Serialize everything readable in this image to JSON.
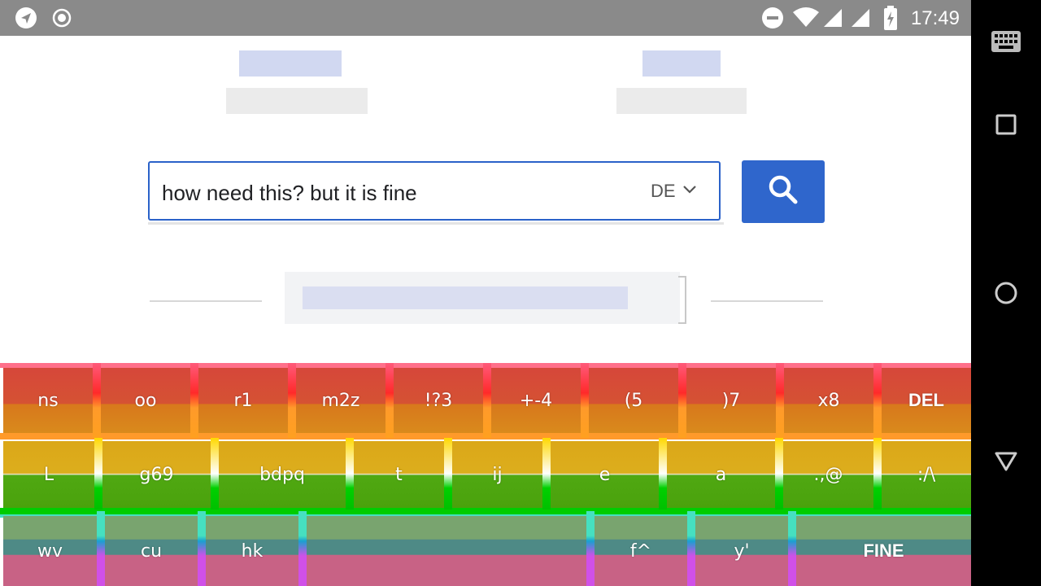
{
  "status_bar": {
    "time": "17:49",
    "icons": [
      "navigation-icon",
      "record-icon",
      "do-not-disturb-icon",
      "wifi-icon",
      "signal-icon",
      "signal-icon",
      "battery-charging-icon"
    ]
  },
  "search": {
    "query": "how need this? but it is fine",
    "language": "DE",
    "button_icon": "search-icon"
  },
  "keyboard": {
    "row1": [
      "ns",
      "oo",
      "r1",
      "m2z",
      "!?3",
      "+-4",
      "(5",
      ")7",
      "x8",
      "DEL"
    ],
    "row2": [
      "L",
      "g69",
      "bdpq",
      "t",
      "ij",
      "e",
      "a",
      ".,@",
      ":/\\"
    ],
    "row3": [
      "wv",
      "cu",
      "hk",
      "",
      "f^",
      "y'",
      "FINE"
    ]
  },
  "nav_bar": {
    "buttons": [
      "keyboard-icon",
      "recents-icon",
      "home-icon",
      "back-icon"
    ]
  },
  "colors": {
    "accent": "#2f66cc",
    "status_bar": "#8a8a8a",
    "nav_bar": "#000000"
  }
}
